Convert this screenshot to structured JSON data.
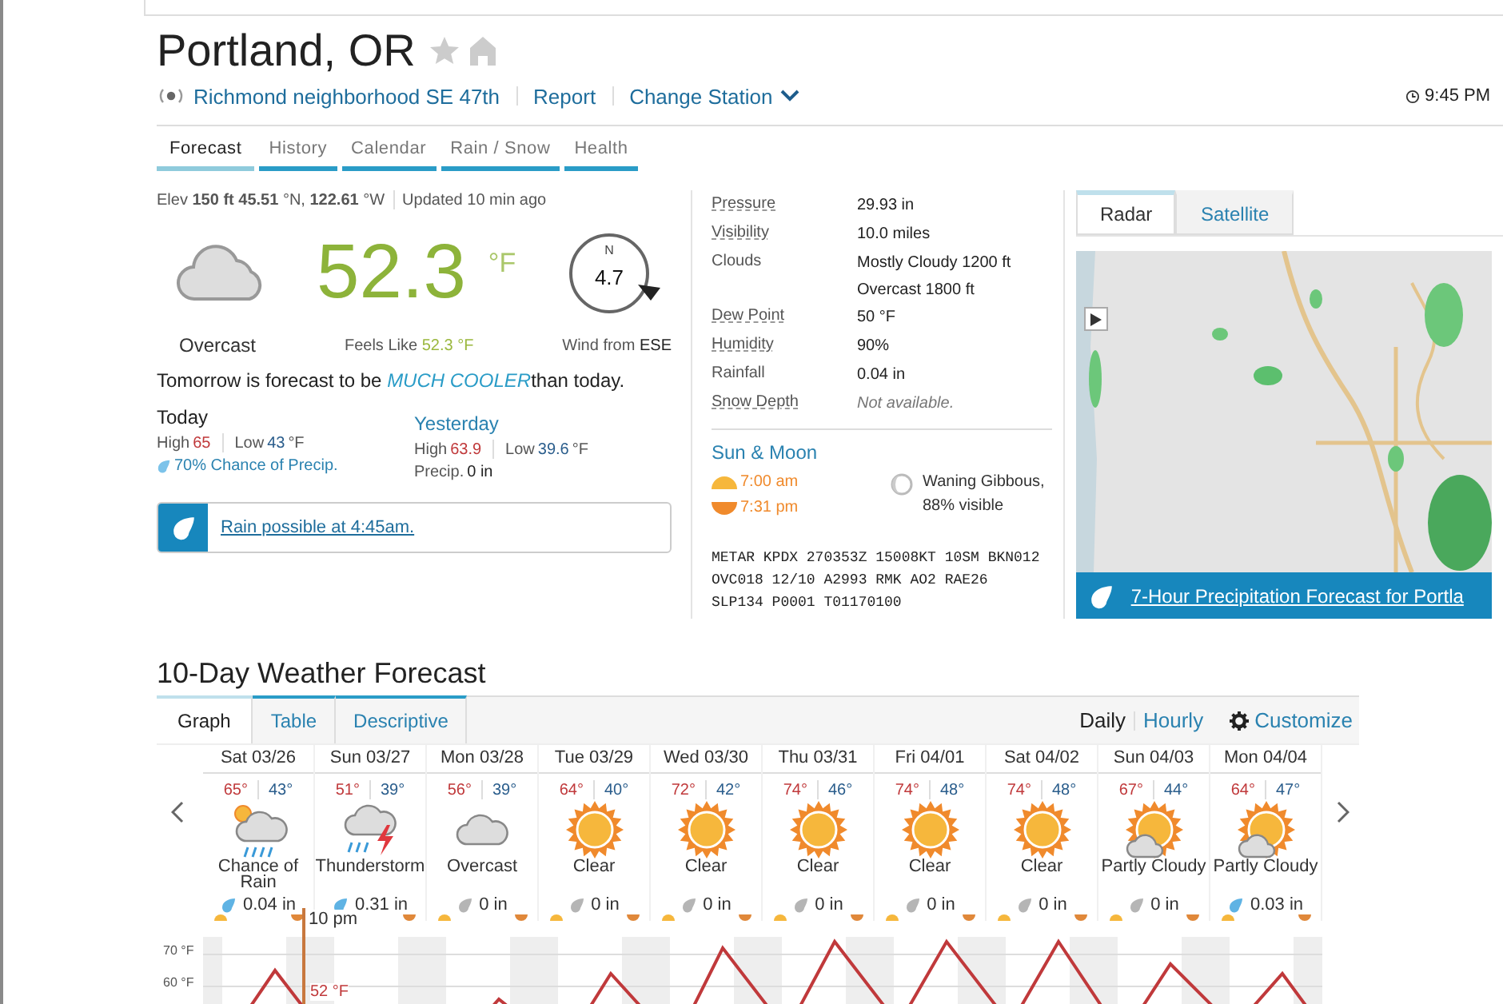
{
  "location": {
    "title": "Portland, OR"
  },
  "station": {
    "name": "Richmond neighborhood SE 47th",
    "report": "Report",
    "change": "Change Station"
  },
  "clock": "9:45 PM",
  "tabs": [
    {
      "label": "Forecast",
      "selected": true
    },
    {
      "label": "History",
      "selected": false
    },
    {
      "label": "Calendar",
      "selected": false
    },
    {
      "label": "Rain / Snow",
      "selected": false
    },
    {
      "label": "Health",
      "selected": false
    }
  ],
  "meta": {
    "position": "Elev **150 ft 45.51** °N, **122.61** °W",
    "updated": "Updated 10 min ago"
  },
  "current": {
    "temp": "52.3",
    "unit": "°F",
    "condition": "Overcast",
    "feels_like_label": "Feels Like",
    "feels_like": "52.3 °F",
    "wind_speed": "4.7",
    "compass_n": "N",
    "wind_label": "Wind from",
    "wind_dir": "ESE"
  },
  "outlook": {
    "before": "Tomorrow is forecast to be",
    "highlight": "MUCH COOLER",
    "after": "than today."
  },
  "today": {
    "title": "Today",
    "high_label": "High",
    "high": "65",
    "low_label": "Low",
    "low": "43",
    "unit": "°F",
    "precip": "70% Chance of Precip."
  },
  "yesterday": {
    "title": "Yesterday",
    "high_label": "High",
    "high": "63.9",
    "low_label": "Low",
    "low": "39.6",
    "unit": "°F",
    "precip_label": "Precip.",
    "precip": "0 in"
  },
  "alert": "Rain possible at 4:45am.",
  "conditions": [
    {
      "label": "Pressure",
      "lines": [
        "29.93 in"
      ],
      "underlined": true,
      "italic": false
    },
    {
      "label": "Visibility",
      "lines": [
        "10.0 miles"
      ],
      "underlined": true,
      "italic": false
    },
    {
      "label": "Clouds",
      "lines": [
        "Mostly Cloudy 1200 ft",
        "Overcast 1800 ft"
      ],
      "underlined": false,
      "italic": false
    },
    {
      "label": "Dew Point",
      "lines": [
        "50 °F"
      ],
      "underlined": true,
      "italic": false
    },
    {
      "label": "Humidity",
      "lines": [
        "90%"
      ],
      "underlined": true,
      "italic": false
    },
    {
      "label": "Rainfall",
      "lines": [
        "0.04 in"
      ],
      "underlined": false,
      "italic": false
    },
    {
      "label": "Snow Depth",
      "lines": [
        "Not available."
      ],
      "underlined": true,
      "italic": true
    }
  ],
  "sun_moon": {
    "title": "Sun & Moon",
    "sunrise": "7:00 am",
    "sunset": "7:31 pm",
    "moon": [
      "Waning Gibbous,",
      "88% visible"
    ]
  },
  "metar": [
    "METAR KPDX 270353Z 15008KT 10SM BKN012",
    "OVC018 12/10 A2993 RMK AO2 RAE26",
    "SLP134 P0001 T01170100"
  ],
  "map": {
    "tabs": [
      {
        "label": "Radar",
        "selected": true
      },
      {
        "label": "Satellite",
        "selected": false
      }
    ],
    "link": "7-Hour Precipitation Forecast for Portla"
  },
  "forecast": {
    "title": "10-Day Weather Forecast",
    "tabs": [
      {
        "label": "Graph",
        "selected": true
      },
      {
        "label": "Table",
        "selected": false
      },
      {
        "label": "Descriptive",
        "selected": false
      }
    ],
    "modes": [
      {
        "label": "Daily",
        "selected": true
      },
      {
        "label": "Hourly",
        "selected": false
      }
    ],
    "customize": "Customize",
    "days": [
      {
        "date": "Sat 03/26",
        "high": "65°",
        "low": "43°",
        "kind": "rain",
        "condition": "Chance of Rain",
        "precip": "0.04 in",
        "color": "#5fb3e4"
      },
      {
        "date": "Sun 03/27",
        "high": "51°",
        "low": "39°",
        "kind": "storm",
        "condition": "Thunderstorm",
        "precip": "0.31 in",
        "color": "#5fb3e4"
      },
      {
        "date": "Mon 03/28",
        "high": "56°",
        "low": "39°",
        "kind": "cloud",
        "condition": "Overcast",
        "precip": "0 in",
        "color": "#b5b5b5"
      },
      {
        "date": "Tue 03/29",
        "high": "64°",
        "low": "40°",
        "kind": "sun",
        "condition": "Clear",
        "precip": "0 in",
        "color": "#b5b5b5"
      },
      {
        "date": "Wed 03/30",
        "high": "72°",
        "low": "42°",
        "kind": "sun",
        "condition": "Clear",
        "precip": "0 in",
        "color": "#b5b5b5"
      },
      {
        "date": "Thu 03/31",
        "high": "74°",
        "low": "46°",
        "kind": "sun",
        "condition": "Clear",
        "precip": "0 in",
        "color": "#b5b5b5"
      },
      {
        "date": "Fri 04/01",
        "high": "74°",
        "low": "48°",
        "kind": "sun",
        "condition": "Clear",
        "precip": "0 in",
        "color": "#b5b5b5"
      },
      {
        "date": "Sat 04/02",
        "high": "74°",
        "low": "48°",
        "kind": "sun",
        "condition": "Clear",
        "precip": "0 in",
        "color": "#b5b5b5"
      },
      {
        "date": "Sun 04/03",
        "high": "67°",
        "low": "44°",
        "kind": "partly",
        "condition": "Partly Cloudy",
        "precip": "0 in",
        "color": "#b5b5b5"
      },
      {
        "date": "Mon 04/04",
        "high": "64°",
        "low": "47°",
        "kind": "partly",
        "condition": "Partly Cloudy",
        "precip": "0.03 in",
        "color": "#5fb3e4"
      }
    ],
    "graph": {
      "y_labels": [
        "70 °F",
        "60 °F"
      ],
      "now_time": "10 pm",
      "now_temp": "52 °F"
    }
  }
}
